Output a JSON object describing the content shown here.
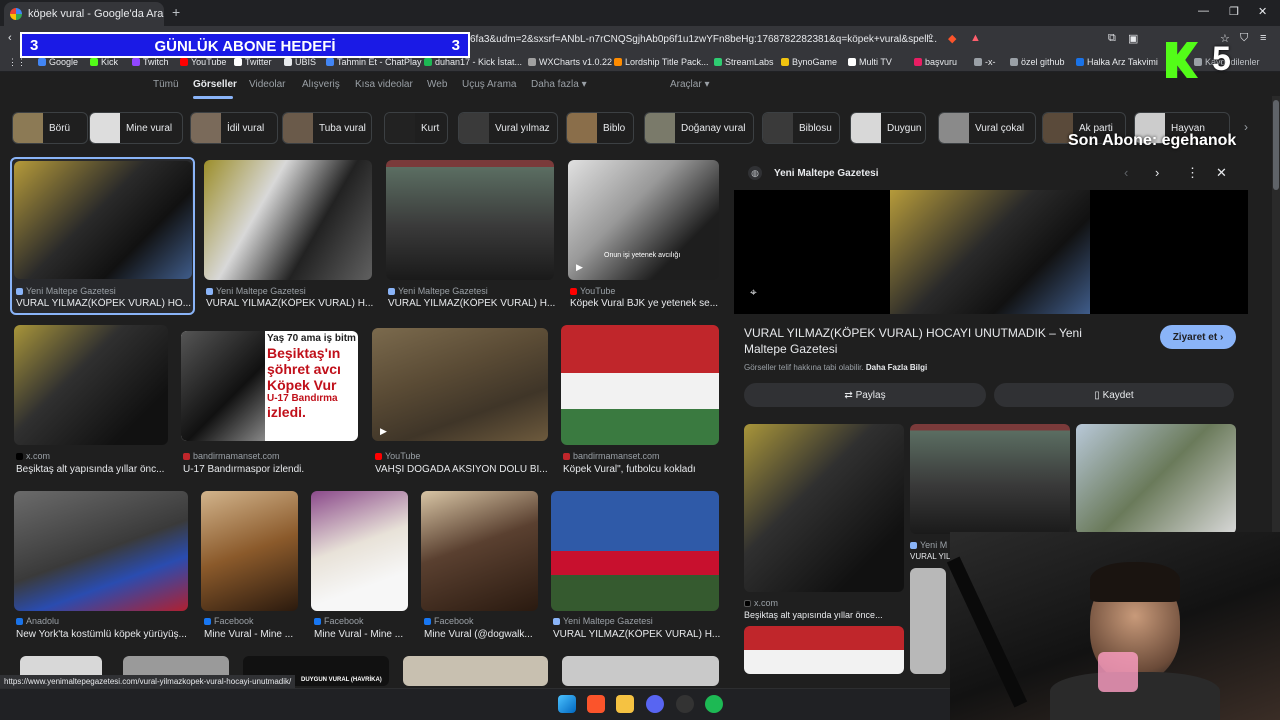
{
  "browser": {
    "tab_title": "köpek vural - Google'da Ara",
    "url": "6fa3&udm=2&sxsrf=ANbL-n7rCNQSgjhAb0p6f1u1zwYFn8beHg:1768782282381&q=köpek+vural&spell...",
    "bookmarks": [
      "Google",
      "Kick",
      "Twitch",
      "YouTube",
      "Twitter",
      "UBIS",
      "Tahmin Et - ChatPlay",
      "duhan17 - Kick İstat...",
      "WXCharts v1.0.22",
      "Lordship Title Pack...",
      "StreamLabs",
      "BynoGame",
      "Multi TV",
      "başvuru",
      "-x-",
      "özel github",
      "Halka Arz Takvimi"
    ],
    "saved_label": "Kaydedilenler"
  },
  "overlay": {
    "goal_left": "3",
    "goal_title": "GÜNLÜK ABONE HEDEFİ",
    "goal_right": "3",
    "kick_count": "5",
    "last_sub": "Son Abone: egehanok"
  },
  "nav": {
    "tabs": [
      "Tümü",
      "Görseller",
      "Videolar",
      "Alışveriş",
      "Kısa videolar",
      "Web",
      "Uçuş Arama",
      "Daha fazla ▾"
    ],
    "tools": "Araçlar ▾"
  },
  "chips": [
    "Börü",
    "Mine vural",
    "İdil vural",
    "Tuba vural",
    "Kurt",
    "Vural yılmaz",
    "Biblo",
    "Doğanay vural",
    "Biblosu",
    "Duygun",
    "Vural çokal",
    "Ak parti",
    "Hayvan"
  ],
  "results": {
    "row1": [
      {
        "source": "Yeni Maltepe Gazetesi",
        "caption": "VURAL YILMAZ(KÖPEK VURAL) HO..."
      },
      {
        "source": "Yeni Maltepe Gazetesi",
        "caption": "VURAL YILMAZ(KÖPEK VURAL) H..."
      },
      {
        "source": "Yeni Maltepe Gazetesi",
        "caption": "VURAL YILMAZ(KÖPEK VURAL) H..."
      },
      {
        "source": "YouTube",
        "caption": "Köpek Vural BJK ye yetenek se..."
      }
    ],
    "row2": [
      {
        "source": "x.com",
        "caption": "Beşiktaş alt yapısında yıllar önc..."
      },
      {
        "source": "bandirmamanset.com",
        "caption": "U-17 Bandırmaspor izlendi."
      },
      {
        "source": "YouTube",
        "caption": "VAHŞİ DOĞADA AKSİYON DOLU Bİ..."
      },
      {
        "source": "bandirmamanset.com",
        "caption": "Köpek Vural\", futbolcu kokladı"
      }
    ],
    "row3": [
      {
        "source": "Anadolu",
        "caption": "New York'ta kostümlü köpek yürüyüş..."
      },
      {
        "source": "Facebook",
        "caption": "Mine Vural - Mine ..."
      },
      {
        "source": "Facebook",
        "caption": "Mine Vural - Mine ..."
      },
      {
        "source": "Facebook",
        "caption": "Mine Vural (@dogwalk..."
      },
      {
        "source": "Yeni Maltepe Gazetesi",
        "caption": "VURAL YILMAZ(KÖPEK VURAL) H..."
      }
    ],
    "yt_caption": "Onun işi yetenek avcılığı",
    "news_text": [
      "Yaş 70 ama iş bitm",
      "Beşiktaş'ın",
      "şöhret avcı",
      "Köpek Vur",
      "U-17 Bandırma",
      "izledi."
    ]
  },
  "panel": {
    "site": "Yeni Maltepe Gazetesi",
    "title": "VURAL YILMAZ(KÖPEK VURAL) HOCAYI UNUTMADIK – Yeni Maltepe Gazetesi",
    "visit": "Ziyaret et ›",
    "copyright": "Görseller telif hakkına tabi olabilir.",
    "more_info": "Daha Fazla Bilgi",
    "share": "Paylaş",
    "save": "Kaydet",
    "related_source": "x.com",
    "related_caption": "Beşiktaş alt yapısında yıllar önce...",
    "related_source2": "Yeni M",
    "related_caption2": "VURAL YIL"
  },
  "status_url": "https://www.yenimaltepegazetesi.com/vural-yilmazkopek-vural-hocayi-unutmadik/",
  "thumb_label": "DUYGUN VURAL (HAVRİKA)"
}
